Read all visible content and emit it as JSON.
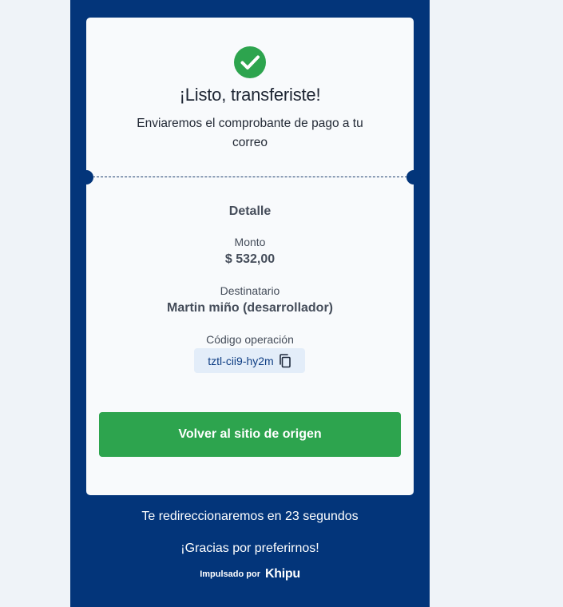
{
  "receipt": {
    "title": "¡Listo, transferiste!",
    "subtitle": "Enviaremos el comprobante de pago a tu correo",
    "detail_heading": "Detalle",
    "amount_label": "Monto",
    "amount_value": "$ 532,00",
    "recipient_label": "Destinatario",
    "recipient_value": "Martin miño (desarrollador)",
    "operation_label": "Código operación",
    "operation_code": "tztl-cii9-hy2m",
    "back_button": "Volver al sitio de origen"
  },
  "footer": {
    "redirect_text": "Te redireccionaremos en 23 segundos",
    "thanks_text": "¡Gracias por preferirnos!",
    "powered_by": "Impulsado por",
    "brand": "Khipu"
  },
  "icons": {
    "success": "check-circle-icon",
    "copy": "copy-icon"
  },
  "colors": {
    "panel": "#03357a",
    "success": "#2da44e",
    "chip": "#e3edf9"
  }
}
